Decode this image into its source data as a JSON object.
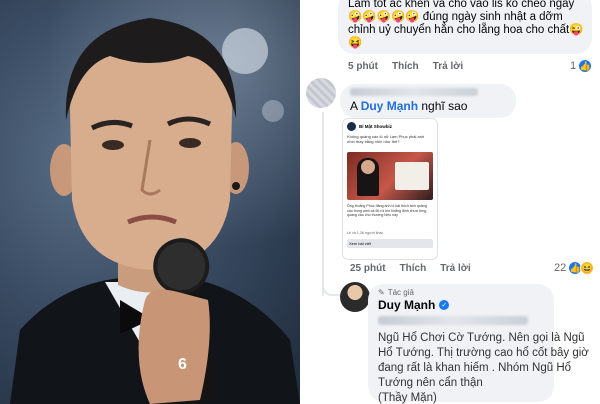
{
  "photo": {
    "alt_subject": "singer-with-microphone",
    "mic_number": "6"
  },
  "comment1": {
    "text_line1": "Làm tốt ắc khen và cho vào lis ko chéo ngày",
    "text_line2": "🤪🤪🤪🤪🤪 đúng ngày sinh nhật a dỡm",
    "text_line3": "chỉnh uỷ chuyển hẳn cho lẵng hoa cho chất😜",
    "text_line4": "😝",
    "time": "5 phút",
    "like": "Thích",
    "reply": "Trả lời",
    "reaction_count": "1"
  },
  "comment2": {
    "prefix": "A",
    "mention": "Duy Mạnh",
    "suffix": "nghĩ sao",
    "time": "25 phút",
    "like": "Thích",
    "reply": "Trả lời",
    "reaction_count": "22"
  },
  "embedded_post": {
    "page_name": "Bí Mật Showbiz",
    "caption": "Không quảng cáo lô nữ Lam Phục phải anh nhìn thay bằng nhìn như thế?",
    "body": "Ông Hoàng Phúc đăng ảnh lộ bài thích ảnh quảng cáo trong web cá độ rồi lên khẳng định chưa từng quảng cáo cho thương hiệu này",
    "likes": "Lê và 1,3K người khác",
    "cta": "Xem bài viết"
  },
  "reply": {
    "author_badge": "Tác giả",
    "author": "Duy Mạnh",
    "line1": "Ngũ Hổ Chơi Cờ Tướng. Nên gọi là Ngũ",
    "line2": "Hổ Tướng. Thị trường cao hổ cốt bây giờ",
    "line3": "đang rất là khan hiếm . Nhóm Ngũ Hổ",
    "line4": "Tướng nên cẩn thận",
    "line5": "(Thầy Mặn)"
  },
  "colors": {
    "mention": "#216fdb",
    "bubble": "#f0f2f5",
    "meta": "#65676b",
    "verified": "#1877f2"
  }
}
